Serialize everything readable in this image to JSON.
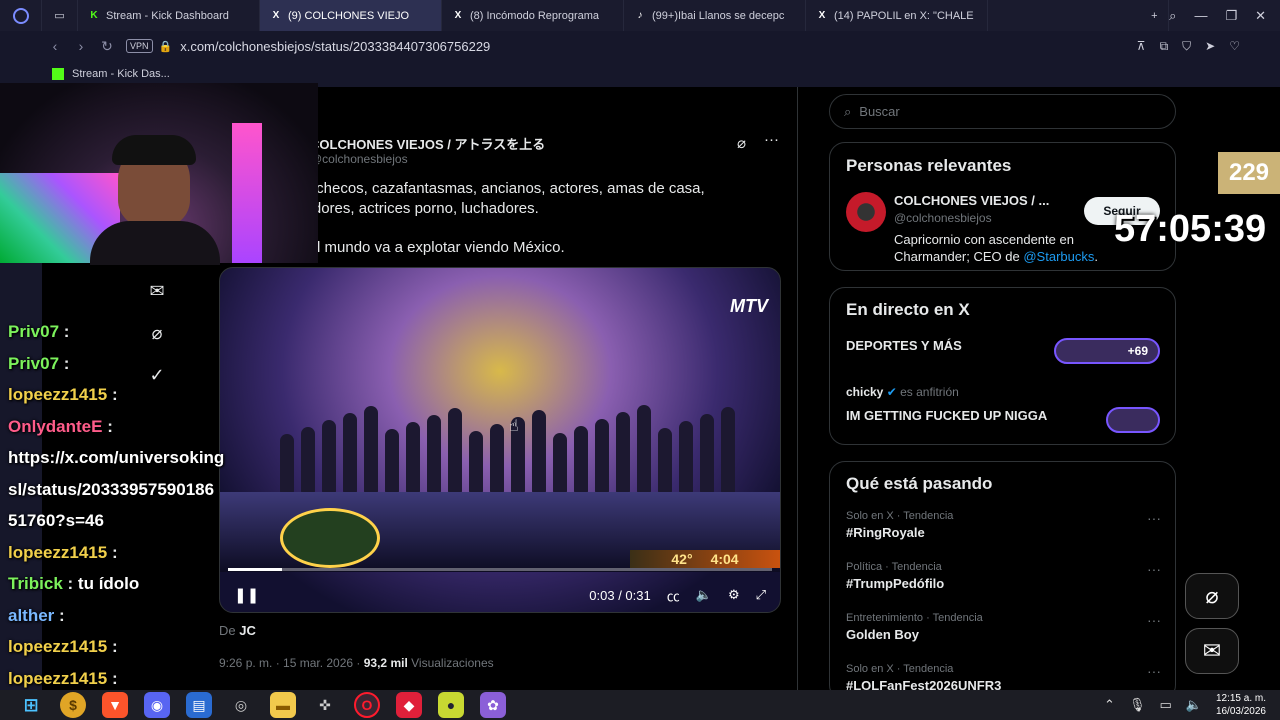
{
  "tabs": [
    {
      "label": "Stream - Kick Dashboard",
      "icon": "kick-icon",
      "color": "#53fc18",
      "active": false
    },
    {
      "label": "(9) COLCHONES VIEJO",
      "icon": "x-icon",
      "color": "#ffffff",
      "active": true
    },
    {
      "label": "(8) Incómodo Reprograma",
      "icon": "x-icon",
      "color": "#ffffff",
      "active": false
    },
    {
      "label": "(99+)Ibai Llanos se decepc",
      "icon": "tiktok-icon",
      "color": "#ffffff",
      "active": false
    },
    {
      "label": "(14) PAPOLIL en X: \"CHALE",
      "icon": "x-icon",
      "color": "#ffffff",
      "active": false
    }
  ],
  "address": {
    "vpn": "VPN",
    "url": "x.com/colchonesbiejos/status/2033384407306756229"
  },
  "bookmark": {
    "label": "Stream - Kick Das..."
  },
  "tweet": {
    "author_name": "COLCHONES VIEJOS / アトラスを上る",
    "handle": "@colchonesbiejos",
    "text_line1": "Frikis, checos, cazafantasmas, ancianos, actores, amas de casa,",
    "text_line2": "boxeadores, actrices porno, luchadores.",
    "text_line3": "Todo el mundo va a explotar viendo México.",
    "video_time": "0:03 / 0:31",
    "video_progress": 0.1,
    "channel_logo": "MTV",
    "overlay_temp": "42°",
    "overlay_clock": "4:04",
    "from_prefix": "De",
    "from_user": "JC",
    "timestamp": "9:26 p. m. · 15 mar. 2026",
    "views": "93,2 mil",
    "views_label": "Visualizaciones"
  },
  "sidebar": {
    "search_placeholder": "Buscar",
    "relevant_title": "Personas relevantes",
    "relevant_name": "COLCHONES VIEJOS / ...",
    "relevant_handle": "@colchonesbiejos",
    "follow_label": "Seguir",
    "bio_line1": "Capricornio con ascendente en",
    "bio_line2": "Charmander; CEO de",
    "bio_link": "@Starbucks",
    "bio_end": ".",
    "live_title": "En directo en X",
    "live1_title": "DEPORTES Y MÁS",
    "live1_count": "+69",
    "live2_host": "chicky",
    "live2_host_suffix": "es anfitrión",
    "live2_title": "IM GETTING FUCKED UP NIGGA",
    "trends_title": "Qué está pasando",
    "trends": [
      {
        "meta": "Solo en X · Tendencia",
        "name": "#RingRoyale"
      },
      {
        "meta": "Política · Tendencia",
        "name": "#TrumpPedófilo"
      },
      {
        "meta": "Entretenimiento · Tendencia",
        "name": "Golden Boy"
      },
      {
        "meta": "Solo en X · Tendencia",
        "name": "#LOLFanFest2026UNFR3"
      }
    ]
  },
  "overlay": {
    "counter": "229",
    "timer": "57:05:39",
    "chat": [
      {
        "user": "Priv07",
        "color": "#7cf25c",
        "msg": ""
      },
      {
        "user": "Priv07",
        "color": "#7cf25c",
        "msg": ""
      },
      {
        "user": "lopeezz1415",
        "color": "#f1d04b",
        "msg": ""
      },
      {
        "user": "OnlydanteE",
        "color": "#ff5c8a",
        "msg": ""
      },
      {
        "user": "",
        "color": "#ffffff",
        "msg": "https://x.com/universoking"
      },
      {
        "user": "",
        "color": "#ffffff",
        "msg": "sl/status/20333957590186"
      },
      {
        "user": "",
        "color": "#ffffff",
        "msg": "51760?s=46"
      },
      {
        "user": "lopeezz1415",
        "color": "#f1d04b",
        "msg": ""
      },
      {
        "user": "Tribick",
        "color": "#7cf25c",
        "msg": "tu ídolo"
      },
      {
        "user": "alther",
        "color": "#7ab8ff",
        "msg": ""
      },
      {
        "user": "lopeezz1415",
        "color": "#f1d04b",
        "msg": ""
      },
      {
        "user": "lopeezz1415",
        "color": "#f1d04b",
        "msg": ""
      }
    ]
  },
  "taskbar": {
    "time": "12:15 a. m.",
    "date": "16/03/2026"
  }
}
